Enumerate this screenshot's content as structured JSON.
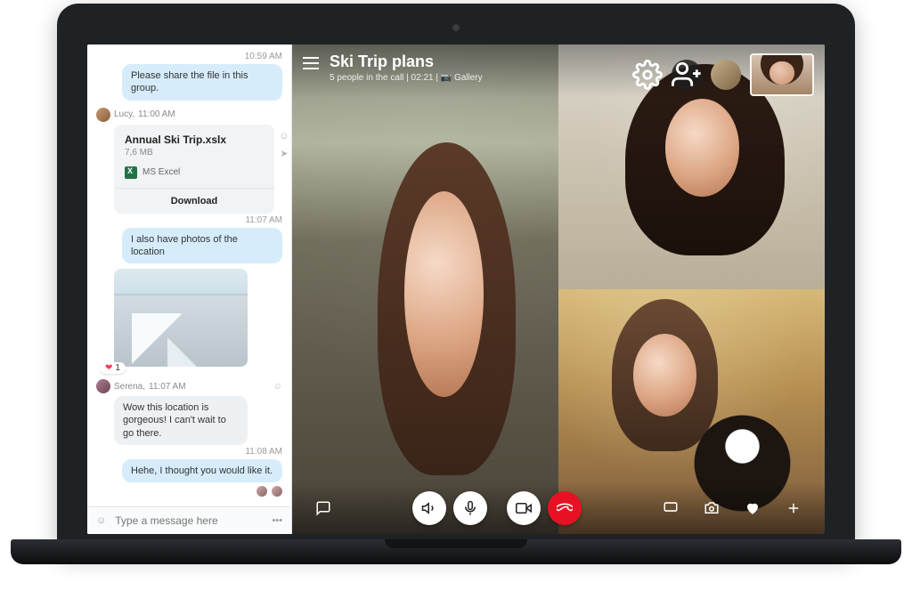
{
  "chat": {
    "times": {
      "t1": "10:59 AM",
      "t2": "11:07 AM",
      "t3": "11:08 AM"
    },
    "msg_share": "Please share the file in this group.",
    "sender1": {
      "name": "Lucy,",
      "time": "11:00 AM"
    },
    "file": {
      "name": "Annual Ski Trip.xslx",
      "size": "7,6 MB",
      "app": "MS Excel",
      "download": "Download"
    },
    "msg_photos": "I also have photos of the location",
    "heart_count": "1",
    "sender2": {
      "name": "Serena,",
      "time": "11:07 AM"
    },
    "msg_wow": "Wow this location is gorgeous! I can't wait to go there.",
    "msg_hehe": "Hehe, I thought you would like it.",
    "composer_placeholder": "Type a message here"
  },
  "call": {
    "title": "Ski Trip plans",
    "subtitle": "5 people in the call  |  02:21  |  📷 Gallery"
  }
}
